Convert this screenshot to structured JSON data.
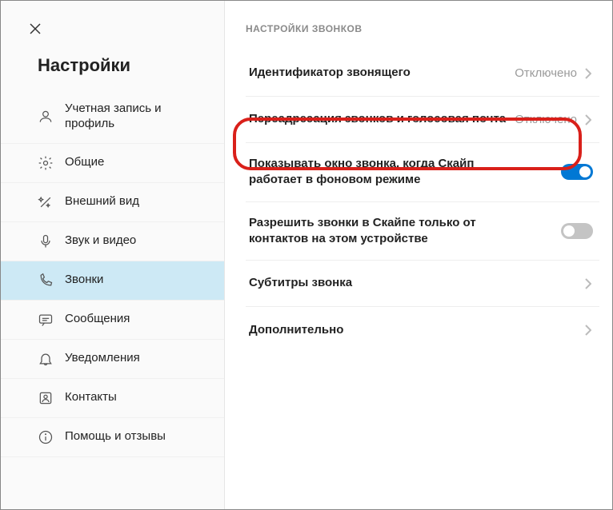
{
  "sidebar": {
    "title": "Настройки",
    "items": [
      {
        "label": "Учетная запись и профиль"
      },
      {
        "label": "Общие"
      },
      {
        "label": "Внешний вид"
      },
      {
        "label": "Звук и видео"
      },
      {
        "label": "Звонки"
      },
      {
        "label": "Сообщения"
      },
      {
        "label": "Уведомления"
      },
      {
        "label": "Контакты"
      },
      {
        "label": "Помощь и отзывы"
      }
    ]
  },
  "content": {
    "section_header": "НАСТРОЙКИ ЗВОНКОВ",
    "rows": {
      "caller_id": {
        "label": "Идентификатор звонящего",
        "value": "Отключено"
      },
      "forwarding": {
        "label": "Переадресация звонков и голосовая почта",
        "value": "Отключено"
      },
      "show_window": {
        "label": "Показывать окно звонка, когда Скайп работает в фоновом режиме"
      },
      "contacts_only": {
        "label": "Разрешить звонки в Скайпе только от контактов на этом устройстве"
      },
      "subtitles": {
        "label": "Субтитры звонка"
      },
      "advanced": {
        "label": "Дополнительно"
      }
    }
  }
}
